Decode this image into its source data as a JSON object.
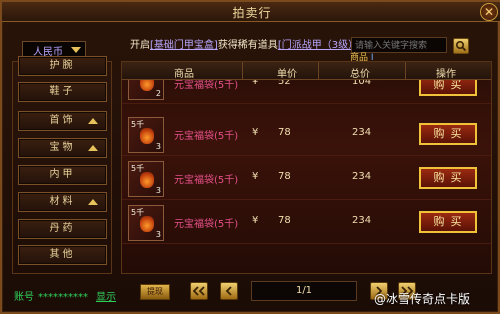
{
  "window": {
    "title": "拍卖行"
  },
  "currency": {
    "selected": "人民币"
  },
  "announcement": {
    "prefix": "开启",
    "item1": "[基础门甲宝盒]",
    "mid": "获得稀有道具",
    "item2": "[门派战甲（3级）]"
  },
  "search": {
    "placeholder": "请输入关键字搜索",
    "tag": "商品",
    "cursor": "I"
  },
  "categories": [
    {
      "label": "护腕",
      "has_arrow": false
    },
    {
      "label": "鞋子",
      "has_arrow": false
    },
    {
      "label": "首饰",
      "has_arrow": true
    },
    {
      "label": "宝物",
      "has_arrow": true
    },
    {
      "label": "内甲",
      "has_arrow": false
    },
    {
      "label": "材料",
      "has_arrow": true
    },
    {
      "label": "丹药",
      "has_arrow": false
    },
    {
      "label": "其他",
      "has_arrow": false
    }
  ],
  "table": {
    "headers": {
      "name": "商品",
      "unit": "单价",
      "total": "总价",
      "op": "操作"
    },
    "rows": [
      {
        "qty_top": "",
        "qty_bottom": "2",
        "name": "元宝福袋(5千)",
        "currency": "¥",
        "unit": "52",
        "total": "104",
        "buy": "购买"
      },
      {
        "qty_top": "5千",
        "qty_bottom": "3",
        "name": "元宝福袋(5千)",
        "currency": "¥",
        "unit": "78",
        "total": "234",
        "buy": "购买"
      },
      {
        "qty_top": "5千",
        "qty_bottom": "3",
        "name": "元宝福袋(5千)",
        "currency": "¥",
        "unit": "78",
        "total": "234",
        "buy": "购买"
      },
      {
        "qty_top": "5千",
        "qty_bottom": "3",
        "name": "元宝福袋(5千)",
        "currency": "¥",
        "unit": "78",
        "total": "234",
        "buy": "购买"
      }
    ]
  },
  "footer": {
    "account_label": "账号",
    "account_mask": "**********",
    "show_label": "显示",
    "deposit_label": "提现",
    "page": "1/1"
  },
  "watermark": "@冰雪传奇点卡版",
  "colors": {
    "accent_gold": "#f0c23a",
    "item_pink": "#e7508a",
    "account_green": "#2fd05a"
  }
}
